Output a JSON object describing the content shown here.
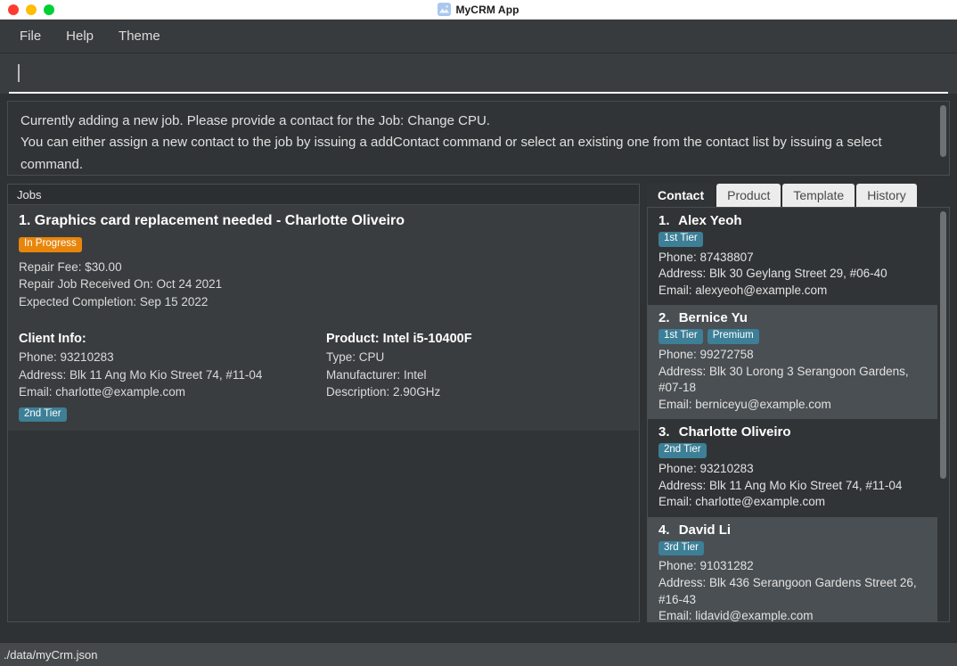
{
  "window": {
    "title": "MyCRM App",
    "app_icon": "image-document-icon",
    "traffic_lights": [
      "close-red",
      "minimize-yellow",
      "zoom-green"
    ]
  },
  "menubar": {
    "items": [
      {
        "label": "File",
        "name": "menu-file"
      },
      {
        "label": "Help",
        "name": "menu-help"
      },
      {
        "label": "Theme",
        "name": "menu-theme"
      }
    ]
  },
  "command_input": {
    "value": "",
    "placeholder": ""
  },
  "result_display": {
    "message": "Currently adding a new job. Please provide a contact for the Job: Change CPU.\nYou can either assign a new contact to the job by issuing a addContact command or select an existing one from the contact list by issuing a select command."
  },
  "jobs_panel": {
    "header": "Jobs",
    "job": {
      "index": "1.",
      "title": "Graphics card replacement needed - Charlotte Oliveiro",
      "status_badge": "In Progress",
      "repair_fee": "Repair Fee: $30.00",
      "received_on": "Repair Job Received On: Oct 24 2021",
      "expected_completion": "Expected Completion: Sep 15 2022",
      "client": {
        "heading": "Client Info:",
        "phone": "Phone: 93210283",
        "address": "Address: Blk 11 Ang Mo Kio Street 74, #11-04",
        "email": "Email: charlotte@example.com",
        "tier_badge": "2nd Tier"
      },
      "product": {
        "heading": "Product: Intel i5-10400F",
        "type": "Type: CPU",
        "manufacturer": "Manufacturer: Intel",
        "description": "Description: 2.90GHz"
      }
    }
  },
  "right_panel": {
    "tabs": [
      {
        "label": "Contact",
        "active": true
      },
      {
        "label": "Product",
        "active": false
      },
      {
        "label": "Template",
        "active": false
      },
      {
        "label": "History",
        "active": false
      }
    ],
    "contacts": [
      {
        "index": "1.",
        "name": "Alex Yeoh",
        "badges": [
          "1st Tier"
        ],
        "phone": "Phone: 87438807",
        "address": "Address: Blk 30 Geylang Street 29, #06-40",
        "email": "Email: alexyeoh@example.com"
      },
      {
        "index": "2.",
        "name": "Bernice Yu",
        "badges": [
          "1st Tier",
          "Premium"
        ],
        "phone": "Phone: 99272758",
        "address": "Address: Blk 30 Lorong 3 Serangoon Gardens, #07-18",
        "email": "Email: berniceyu@example.com"
      },
      {
        "index": "3.",
        "name": "Charlotte Oliveiro",
        "badges": [
          "2nd Tier"
        ],
        "phone": "Phone: 93210283",
        "address": "Address: Blk 11 Ang Mo Kio Street 74, #11-04",
        "email": "Email: charlotte@example.com"
      },
      {
        "index": "4.",
        "name": "David Li",
        "badges": [
          "3rd Tier"
        ],
        "phone": "Phone: 91031282",
        "address": "Address: Blk 436 Serangoon Gardens Street 26, #16-43",
        "email": "Email: lidavid@example.com"
      }
    ]
  },
  "statusbar": {
    "file_path": "./data/myCrm.json"
  },
  "colors": {
    "status_badge": "#e8860c",
    "tier_badge": "#3d7f96",
    "panel_bg": "#313436",
    "card_bg": "#3a3d3f",
    "alt_row_bg": "#4a4f53",
    "tab_inactive_bg": "#ececec",
    "window_bg": "#2f3234"
  }
}
